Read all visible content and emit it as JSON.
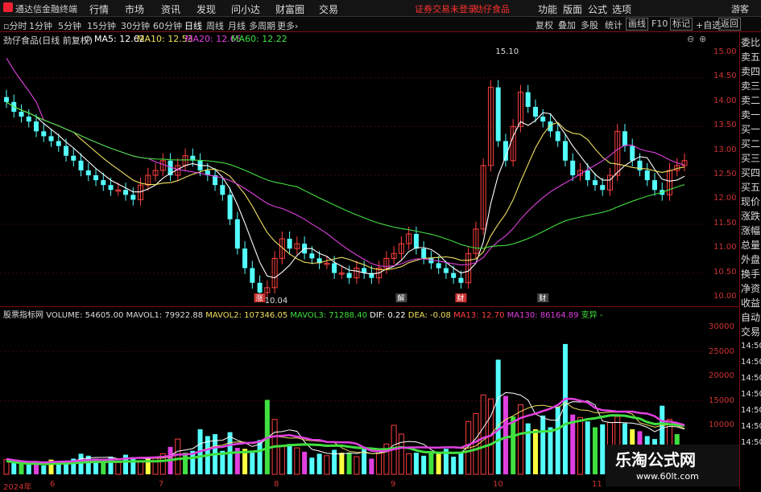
{
  "app": {
    "title": "通达信金融终端"
  },
  "menu": [
    "行情",
    "市场",
    "资讯",
    "发现",
    "问小达",
    "财富圈",
    "交易"
  ],
  "alerts": {
    "login": "证券交易未登录",
    "stock": "劲仔食品"
  },
  "top_right": [
    "功能",
    "版面",
    "公式",
    "选项",
    "游客"
  ],
  "periods": [
    "分时",
    "1分钟",
    "5分钟",
    "15分钟",
    "30分钟",
    "60分钟",
    "日线",
    "周线",
    "月线",
    "多周期",
    "更多"
  ],
  "active_period": "日线",
  "tools": [
    "复权",
    "叠加",
    "多股",
    "统计",
    "画线",
    "F10",
    "标记",
    "+自选",
    "返回"
  ],
  "chart_title": "劲仔食品(日线 前复权)",
  "ma": {
    "ma5": "MA5: 12.62",
    "ma10": "MA10: 12.53",
    "ma20": "MA20: 12.65",
    "ma60": "MA60: 12.22"
  },
  "annotations": {
    "high": "15.10",
    "low": "10.04"
  },
  "indicator_row": {
    "name": "股票指标网",
    "volume": "VOLUME: 54605.00",
    "mavol1": "MAVOL1: 79922.88",
    "mavol2": "MAVOL2: 107346.05",
    "mavol3": "MAVOL3: 71288.40",
    "dif": "DIF: 0.22",
    "dea": "DEA: -0.08",
    "ma13": "MA13: 12.70",
    "ma130": "MA130: 86164.89",
    "signal": "变异 -"
  },
  "price_axis": [
    "15.00",
    "14.50",
    "14.00",
    "13.50",
    "13.00",
    "12.50",
    "12.00",
    "11.50",
    "11.00",
    "10.50",
    "10.00"
  ],
  "vol_axis": [
    "30000",
    "25000",
    "20000",
    "15000",
    "10000"
  ],
  "dates": [
    "2024年",
    "6",
    "7",
    "8",
    "9",
    "10",
    "11"
  ],
  "right_panel": [
    "委比",
    "卖五",
    "卖四",
    "卖三",
    "卖二",
    "卖一",
    "买一",
    "买二",
    "买三",
    "买四",
    "买五",
    "现价",
    "涨跌",
    "涨幅",
    "总量",
    "外盘",
    "换手",
    "净资",
    "收益",
    "自动",
    "交易"
  ],
  "right_times": [
    "14:50",
    "14:50",
    "14:50",
    "14:50",
    "14:50",
    "14:50",
    "14:50"
  ],
  "markers": [
    "涨",
    "解",
    "财",
    "财"
  ],
  "watermark": {
    "title": "乐淘公式网",
    "url": "www.60lt.com"
  },
  "chart_data": {
    "type": "candlestick",
    "closes": [
      14.0,
      13.8,
      13.7,
      13.6,
      13.4,
      13.3,
      13.2,
      13.1,
      12.9,
      12.8,
      12.6,
      12.5,
      12.4,
      12.3,
      12.2,
      12.2,
      12.1,
      12.0,
      12.3,
      12.5,
      12.6,
      12.8,
      12.5,
      12.7,
      12.9,
      12.8,
      12.6,
      12.5,
      12.3,
      12.1,
      11.6,
      11.0,
      10.6,
      10.3,
      10.1,
      10.2,
      10.8,
      11.2,
      11.0,
      11.1,
      10.9,
      10.8,
      10.7,
      10.7,
      10.5,
      10.5,
      10.4,
      10.6,
      10.5,
      10.4,
      10.6,
      10.8,
      10.9,
      11.1,
      11.3,
      11.0,
      10.8,
      10.7,
      10.6,
      10.5,
      10.4,
      10.3,
      10.9,
      11.4,
      12.7,
      14.3,
      13.2,
      12.8,
      13.5,
      14.2,
      13.9,
      13.7,
      13.6,
      13.4,
      13.2,
      12.8,
      12.5,
      12.6,
      12.4,
      12.3,
      12.2,
      12.5,
      13.4,
      13.1,
      12.8,
      12.6,
      12.4,
      12.2,
      12.1,
      12.6,
      12.7,
      12.8
    ],
    "ylim": [
      10.0,
      15.1
    ],
    "volumes": [
      3000,
      2500,
      2200,
      2000,
      2400,
      1800,
      3000,
      2600,
      2800,
      3200,
      4200,
      3800,
      3200,
      2800,
      3600,
      2400,
      4000,
      3500,
      2800,
      3200,
      3400,
      4200,
      5600,
      7200,
      4400,
      4800,
      9200,
      7800,
      8200,
      4800,
      8600,
      5400,
      5200,
      4400,
      7000,
      15200,
      11200,
      5800,
      6200,
      5400,
      4600,
      3400,
      4200,
      3800,
      5000,
      4400,
      4400,
      3600,
      5600,
      3200,
      5000,
      6200,
      10000,
      8200,
      4200,
      4400,
      3800,
      4600,
      4200,
      5200,
      3600,
      4600,
      10800,
      12400,
      16200,
      15400,
      23400,
      16000,
      11800,
      14200,
      10400,
      9200,
      12000,
      9600,
      13800,
      26600,
      12200,
      11600,
      10800,
      9600,
      10200,
      10600,
      11800,
      10400,
      9200,
      8800,
      7800,
      7200,
      14000,
      11200,
      8200,
      5400
    ],
    "vol_ylim": [
      0,
      32000
    ]
  }
}
